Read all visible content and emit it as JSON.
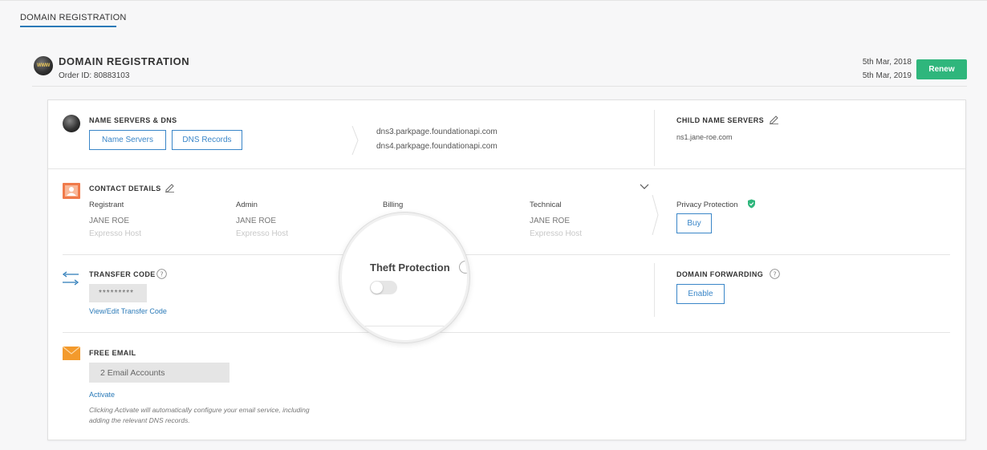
{
  "page": {
    "tab_label": "DOMAIN REGISTRATION"
  },
  "header": {
    "icon_text": "WWW",
    "title": "DOMAIN REGISTRATION",
    "order_id": "Order ID: 80883103",
    "date_start": "5th Mar, 2018",
    "date_end": "5th Mar, 2019",
    "renew_label": "Renew"
  },
  "name_servers": {
    "title": "NAME SERVERS & DNS",
    "btn_name_servers": "Name Servers",
    "btn_dns_records": "DNS Records",
    "ns1": "dns3.parkpage.foundationapi.com",
    "ns2": "dns4.parkpage.foundationapi.com"
  },
  "child_ns": {
    "title": "CHILD NAME SERVERS",
    "value": "ns1.jane-roe.com"
  },
  "contact": {
    "title": "CONTACT DETAILS",
    "columns": [
      {
        "label": "Registrant",
        "name": "JANE ROE",
        "org": "Expresso Host"
      },
      {
        "label": "Admin",
        "name": "JANE ROE",
        "org": "Expresso Host"
      },
      {
        "label": "Billing",
        "name": "",
        "org": ""
      },
      {
        "label": "Technical",
        "name": "JANE ROE",
        "org": "Expresso Host"
      }
    ]
  },
  "privacy": {
    "label": "Privacy Protection",
    "buy_label": "Buy"
  },
  "transfer": {
    "title": "TRANSFER CODE",
    "masked": "*********",
    "link": "View/Edit Transfer Code"
  },
  "theft": {
    "label": "Theft Protection",
    "enabled": false
  },
  "forwarding": {
    "title": "DOMAIN FORWARDING",
    "enable_label": "Enable"
  },
  "email": {
    "title": "FREE EMAIL",
    "accounts": "2 Email Accounts",
    "activate_label": "Activate",
    "note_line1": "Clicking Activate will automatically configure your email service, including",
    "note_line2": "adding the relevant DNS records."
  },
  "colors": {
    "accent": "#2a7ab8",
    "renew": "#2fb67c",
    "contact_icon": "#f07a4a",
    "email_icon": "#f39a2c"
  }
}
